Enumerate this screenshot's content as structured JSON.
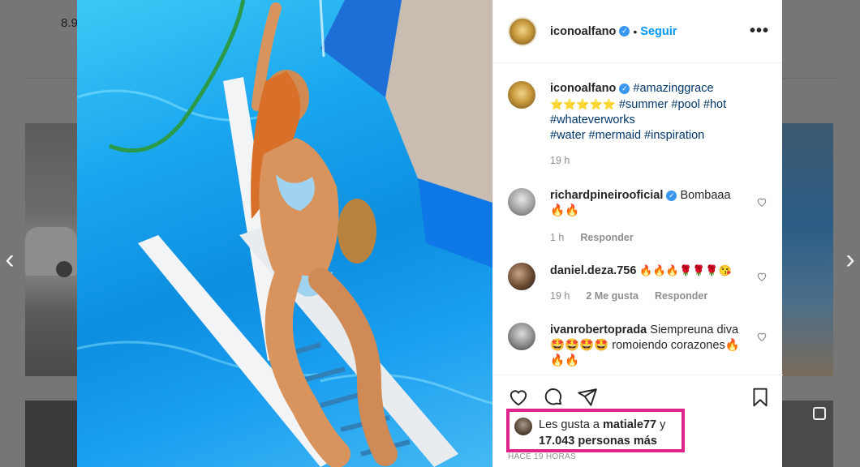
{
  "background": {
    "count_text": "8.9"
  },
  "nav": {
    "prev_glyph": "‹",
    "next_glyph": "›"
  },
  "post": {
    "username": "iconoalfano",
    "separator": "•",
    "follow_label": "Seguir",
    "more_glyph": "•••",
    "caption": {
      "username": "iconoalfano",
      "lines": [
        {
          "tag": "#amazinggrace"
        },
        {
          "stars": "⭐⭐⭐⭐⭐",
          "tags": "#summer #pool #hot"
        },
        {
          "tags": "#whateverworks"
        },
        {
          "tags": "#water #mermaid #inspiration"
        }
      ],
      "time": "19 h"
    },
    "comments": [
      {
        "username": "richardpineirooficial",
        "verified": true,
        "text": "Bombaaa",
        "emoji": "🔥🔥",
        "time": "1 h",
        "likes": "",
        "reply": "Responder"
      },
      {
        "username": "daniel.deza.756",
        "verified": false,
        "text": "",
        "emoji": "🔥🔥🔥🌹🌹🌹😘",
        "time": "19 h",
        "likes": "2 Me gusta",
        "reply": "Responder"
      },
      {
        "username": "ivanrobertoprada",
        "verified": false,
        "text": "Siempreuna diva🤩🤩🤩🤩 romoiendo corazones🔥🔥🔥",
        "emoji": "",
        "time": "",
        "likes": "",
        "reply": ""
      }
    ],
    "likes": {
      "prefix": "Les gusta a",
      "user": "matiale77",
      "joiner": "y",
      "count_text": "17.043 personas más"
    },
    "timestamp": "HACE 19 HORAS"
  },
  "icons": [
    "heart-icon",
    "comment-icon",
    "share-icon",
    "bookmark-icon",
    "verified-icon",
    "more-options-icon"
  ],
  "colors": {
    "accent": "#0095f6",
    "highlight_box": "#e0228b",
    "verified": "#3897f0"
  }
}
